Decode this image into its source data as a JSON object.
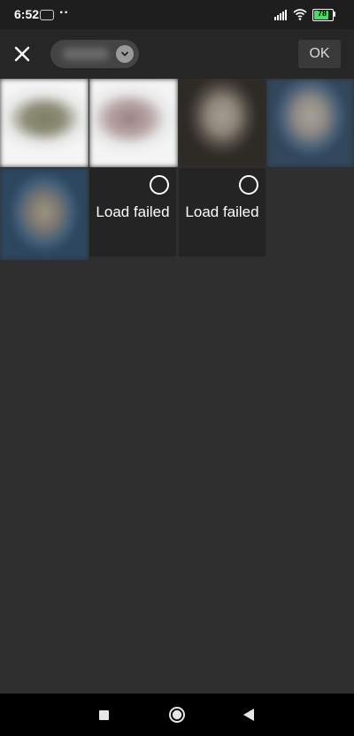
{
  "status_bar": {
    "time": "6:52",
    "notification_dots": "··",
    "battery_level": "78",
    "icons": [
      "carrier-icon",
      "signal-icon",
      "wifi-icon",
      "battery-icon"
    ]
  },
  "toolbar": {
    "close_icon": "close-icon",
    "album_dropdown_icon": "chevron-down-icon",
    "ok_label": "OK"
  },
  "grid": {
    "failed_items": [
      {
        "message": "Load failed"
      },
      {
        "message": "Load failed"
      }
    ]
  },
  "colors": {
    "background": "#2f2f2f",
    "toolbar": "#262626",
    "status_bar": "#1e1e1e",
    "battery_fill": "#4cd964"
  }
}
